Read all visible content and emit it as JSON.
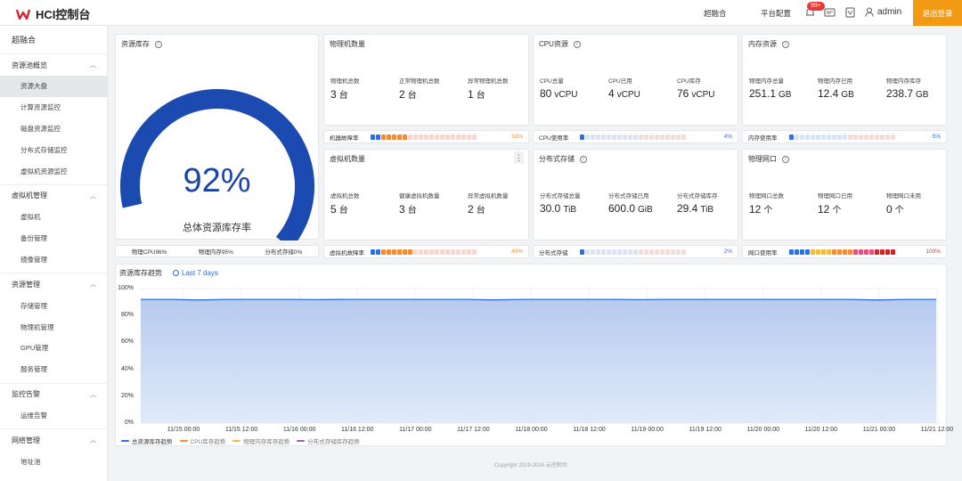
{
  "header": {
    "app_title": "HCI控制台",
    "nav": [
      "超融合",
      "平台配置"
    ],
    "notification_count": "99+",
    "user": "admin",
    "logout_label": "退出登录"
  },
  "sidebar": {
    "top": "超融合",
    "groups": [
      {
        "label": "资源池概览",
        "items": [
          "资源大盘",
          "计算资源监控",
          "磁盘资源监控",
          "分布式存储监控",
          "虚拟机资源监控"
        ]
      },
      {
        "label": "虚拟机管理",
        "items": [
          "虚拟机",
          "备份管理",
          "镜像管理"
        ]
      },
      {
        "label": "资源管理",
        "items": [
          "存储管理",
          "物理机管理",
          "GPU管理",
          "服务管理"
        ]
      },
      {
        "label": "监控告警",
        "items": [
          "运维告警"
        ]
      },
      {
        "label": "网络管理",
        "items": [
          "地址池"
        ]
      }
    ],
    "active_item": "资源大盘"
  },
  "gauge": {
    "title": "资源库存",
    "percent": 92,
    "percent_label": "92%",
    "caption": "总体资源库存率",
    "bottom": [
      "物理CPU96%",
      "物理内存95%",
      "分布式存储0%"
    ]
  },
  "cards": {
    "physical_hosts": {
      "title": "物理机数量",
      "stats": [
        {
          "label": "物理机总数",
          "value": "3",
          "unit": "台"
        },
        {
          "label": "正常物理机总数",
          "value": "2",
          "unit": "台"
        },
        {
          "label": "异常物理机总数",
          "value": "1",
          "unit": "台"
        }
      ]
    },
    "cpu": {
      "title": "CPU资源",
      "stats": [
        {
          "label": "CPU总量",
          "value": "80",
          "unit": "vCPU"
        },
        {
          "label": "CPU已用",
          "value": "4",
          "unit": "vCPU"
        },
        {
          "label": "CPU库存",
          "value": "76",
          "unit": "vCPU"
        }
      ]
    },
    "memory": {
      "title": "内存资源",
      "stats": [
        {
          "label": "物理内存总量",
          "value": "251.1",
          "unit": "GB"
        },
        {
          "label": "物理内存已用",
          "value": "12.4",
          "unit": "GB"
        },
        {
          "label": "物理内存库存",
          "value": "238.7",
          "unit": "GB"
        }
      ]
    },
    "vms": {
      "title": "虚拟机数量",
      "stats": [
        {
          "label": "虚拟机总数",
          "value": "5",
          "unit": "台"
        },
        {
          "label": "健康虚拟机数量",
          "value": "3",
          "unit": "台"
        },
        {
          "label": "异常虚拟机数量",
          "value": "2",
          "unit": "台"
        }
      ]
    },
    "storage": {
      "title": "分布式存储",
      "stats": [
        {
          "label": "分布式存储总量",
          "value": "30.0",
          "unit": "TiB"
        },
        {
          "label": "分布式存储已用",
          "value": "600.0",
          "unit": "GiB"
        },
        {
          "label": "分布式存储库存",
          "value": "29.4",
          "unit": "TiB"
        }
      ]
    },
    "nic": {
      "title": "物理网口",
      "stats": [
        {
          "label": "物理网口总数",
          "value": "12",
          "unit": "个"
        },
        {
          "label": "物理网口已用",
          "value": "12",
          "unit": "个"
        },
        {
          "label": "物理网口未用",
          "value": "0",
          "unit": "个"
        }
      ]
    }
  },
  "bars": {
    "host_fault": {
      "label": "机器故障率",
      "pct": "33%",
      "fraction": 0.33,
      "pct_color": "#f28c38"
    },
    "cpu_usage": {
      "label": "CPU使用率",
      "pct": "4%",
      "fraction": 0.04,
      "pct_color": "#2f6fe0"
    },
    "mem_usage": {
      "label": "内存使用率",
      "pct": "5%",
      "fraction": 0.05,
      "pct_color": "#2f6fe0"
    },
    "vm_fault": {
      "label": "虚拟机故障率",
      "pct": "40%",
      "fraction": 0.4,
      "pct_color": "#f28c38"
    },
    "storage_usage": {
      "label": "分布式存储",
      "pct": "2%",
      "fraction": 0.02,
      "pct_color": "#2f6fe0"
    },
    "nic_usage": {
      "label": "网口使用率",
      "pct": "100%",
      "fraction": 1.0,
      "pct_color": "#e53935"
    }
  },
  "trend": {
    "title": "资源库存趋势",
    "range": "Last 7 days",
    "legend": [
      "总资源库存趋势",
      "CPU库存趋势",
      "物理内存库存趋势",
      "分布式存储库存趋势"
    ],
    "legend_colors": [
      "#2f6fe0",
      "#f28c38",
      "#f5b942",
      "#9b59c6"
    ]
  },
  "chart_data": {
    "type": "area",
    "title": "资源库存趋势",
    "x_ticks": [
      "11/15 00:00",
      "11/15 12:00",
      "11/16 00:00",
      "11/16 12:00",
      "11/17 00:00",
      "11/17 12:00",
      "11/18 00:00",
      "11/18 12:00",
      "11/19 00:00",
      "11/19 12:00",
      "11/20 00:00",
      "11/20 12:00",
      "11/21 00:00",
      "11/21 12:00"
    ],
    "y_ticks": [
      "0%",
      "20%",
      "40%",
      "60%",
      "80%",
      "100%"
    ],
    "ylim": [
      0,
      100
    ],
    "series": [
      {
        "name": "总资源库存趋势",
        "values": [
          92,
          92,
          91.5,
          92,
          92,
          92,
          91.8,
          92,
          92,
          92,
          92,
          92,
          91.6,
          92,
          92,
          92,
          92,
          91.8,
          92,
          92,
          92,
          92,
          92,
          92,
          92,
          91.5,
          92,
          92
        ]
      }
    ]
  },
  "footer": {
    "copyright": "Copyright 2019-2024 云控制台"
  }
}
